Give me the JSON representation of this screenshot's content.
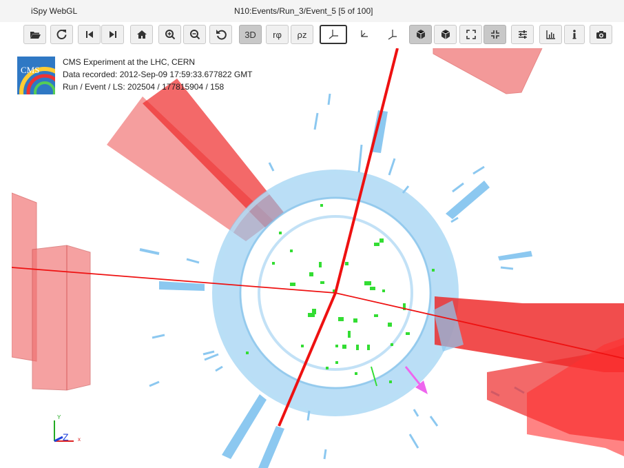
{
  "window": {
    "app_name": "iSpy WebGL",
    "event_path": "N10:Events/Run_3/Event_5 [5 of 100]"
  },
  "toolbar": {
    "buttons": [
      {
        "name": "open-file-button",
        "icon": "folder-open-icon"
      },
      {
        "name": "reload-button",
        "icon": "reload-icon"
      },
      {
        "name": "previous-event-button",
        "icon": "skip-back-icon"
      },
      {
        "name": "next-event-button",
        "icon": "skip-forward-icon"
      },
      {
        "name": "home-view-button",
        "icon": "home-icon"
      },
      {
        "name": "zoom-in-button",
        "icon": "zoom-in-icon"
      },
      {
        "name": "zoom-out-button",
        "icon": "zoom-out-icon"
      },
      {
        "name": "reset-view-button",
        "icon": "undo-icon"
      },
      {
        "name": "view-3d-button",
        "label": "3D",
        "active": true
      },
      {
        "name": "view-rphi-button",
        "label": "rφ"
      },
      {
        "name": "view-rhoz-button",
        "label": "ρz"
      },
      {
        "name": "view-xy-button",
        "icon": "axes-xy-icon",
        "selected": true
      },
      {
        "name": "view-yz-button",
        "icon": "axes-yz-icon"
      },
      {
        "name": "view-xz-button",
        "icon": "axes-xz-icon"
      },
      {
        "name": "perspective-button",
        "icon": "cube-perspective-icon",
        "active": true
      },
      {
        "name": "orthographic-button",
        "icon": "cube-ortho-icon"
      },
      {
        "name": "fullscreen-button",
        "icon": "expand-icon"
      },
      {
        "name": "exit-fullscreen-button",
        "icon": "compress-icon",
        "active": true
      },
      {
        "name": "controls-button",
        "icon": "sliders-icon"
      },
      {
        "name": "charts-button",
        "icon": "bar-chart-icon"
      },
      {
        "name": "info-button",
        "icon": "info-icon"
      },
      {
        "name": "screenshot-button",
        "icon": "camera-icon"
      }
    ]
  },
  "event_info": {
    "experiment": "CMS Experiment at the LHC, CERN",
    "recorded": "Data recorded: 2012-Sep-09 17:59:33.677822 GMT",
    "run_event_ls": "Run / Event / LS: 202504 / 177815904 / 158",
    "logo_text": "CMS"
  },
  "axes": {
    "y_label": "Y",
    "z_label": "Z",
    "x_label": "x"
  },
  "colors": {
    "muon_chamber": "#ff4c4c",
    "ecal": "#8cc8f0",
    "tracker_hits": "#33dd33",
    "muon_track": "#ee1111",
    "met_arrow": "#ee66ee"
  }
}
